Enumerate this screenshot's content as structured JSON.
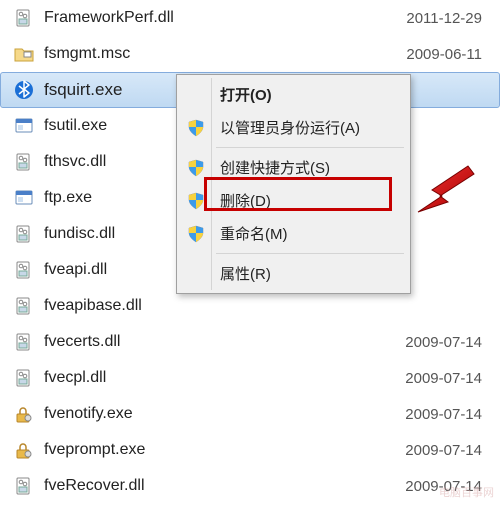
{
  "files": [
    {
      "name": "FrameworkPerf.dll",
      "date": "2011-12-29",
      "icon": "dll"
    },
    {
      "name": "fsmgmt.msc",
      "date": "2009-06-11",
      "icon": "msc"
    },
    {
      "name": "fsquirt.exe",
      "date": "",
      "icon": "bt",
      "selected": true
    },
    {
      "name": "fsutil.exe",
      "date": "",
      "icon": "exe"
    },
    {
      "name": "fthsvc.dll",
      "date": "",
      "icon": "dll"
    },
    {
      "name": "ftp.exe",
      "date": "",
      "icon": "exe"
    },
    {
      "name": "fundisc.dll",
      "date": "",
      "icon": "dll"
    },
    {
      "name": "fveapi.dll",
      "date": "",
      "icon": "dll"
    },
    {
      "name": "fveapibase.dll",
      "date": "",
      "icon": "dll"
    },
    {
      "name": "fvecerts.dll",
      "date": "2009-07-14",
      "icon": "dll"
    },
    {
      "name": "fvecpl.dll",
      "date": "2009-07-14",
      "icon": "dll"
    },
    {
      "name": "fvenotify.exe",
      "date": "2009-07-14",
      "icon": "lock"
    },
    {
      "name": "fveprompt.exe",
      "date": "2009-07-14",
      "icon": "lock"
    },
    {
      "name": "fveRecover.dll",
      "date": "2009-07-14",
      "icon": "dll"
    }
  ],
  "menu": {
    "open": "打开(O)",
    "runAs": "以管理员身份运行(A)",
    "shortcut": "创建快捷方式(S)",
    "delete": "删除(D)",
    "rename": "重命名(M)",
    "props": "属性(R)"
  },
  "colors": {
    "highlight": "#c60000",
    "arrow": "#c60000"
  },
  "watermark": "电脑百事网"
}
